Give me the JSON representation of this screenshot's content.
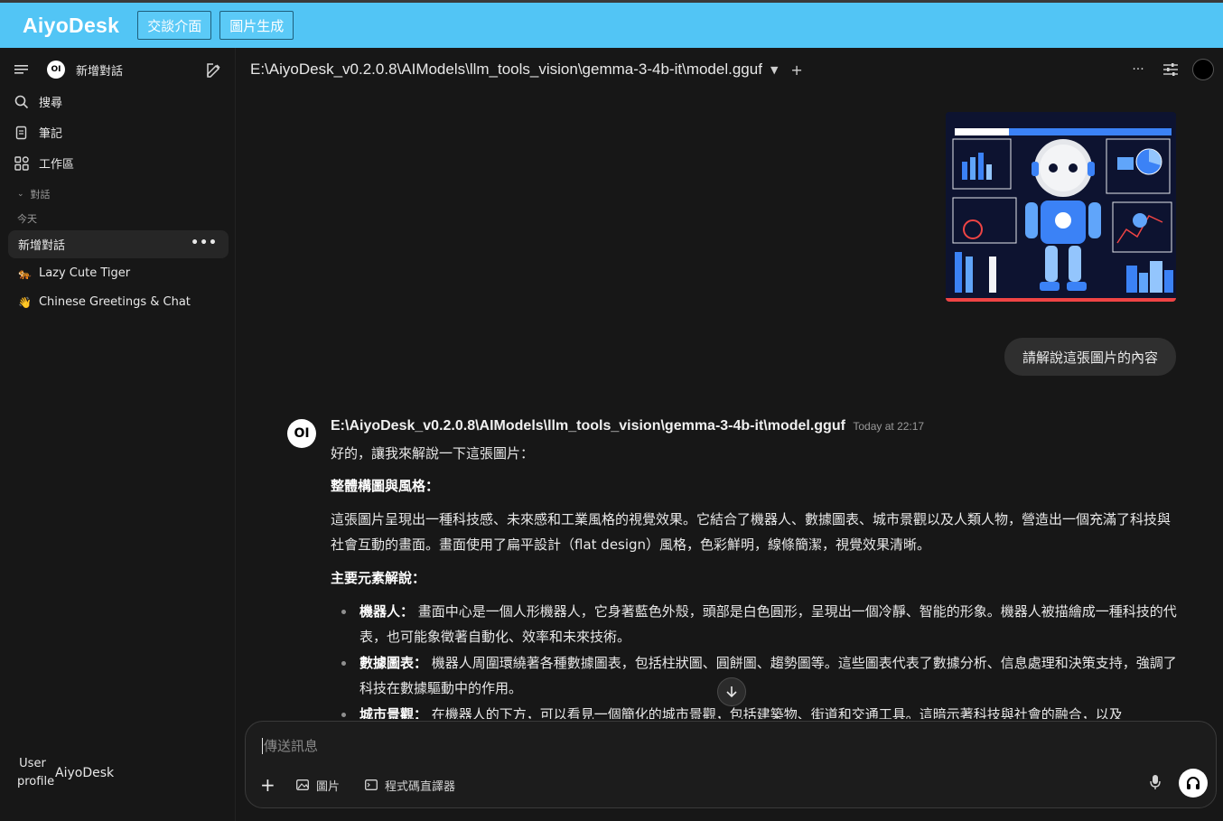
{
  "topbar": {
    "brand": "AiyoDesk",
    "tab_chat": "交談介面",
    "tab_image": "圖片生成"
  },
  "sidebar": {
    "new_chat": "新增對話",
    "search": "搜尋",
    "notes": "筆記",
    "workspace": "工作區",
    "section_chats": "對話",
    "section_today": "今天",
    "chats": [
      {
        "title": "新增對話",
        "emoji": ""
      },
      {
        "title": "Lazy Cute Tiger",
        "emoji": "🐅"
      },
      {
        "title": "Chinese Greetings & Chat",
        "emoji": "👋"
      }
    ],
    "user_image_alt": "User profile",
    "user_name": "AiyoDesk"
  },
  "header": {
    "model": "E:\\AiyoDesk_v0.2.0.8\\AIModels\\llm_tools_vision\\gemma-3-4b-it\\model.gguf"
  },
  "user_message": {
    "text": "請解說這張圖片的內容"
  },
  "assistant": {
    "avatar": "OI",
    "name": "E:\\AiyoDesk_v0.2.0.8\\AIModels\\llm_tools_vision\\gemma-3-4b-it\\model.gguf",
    "time": "Today at 22:17",
    "intro": "好的，讓我來解說一下這張圖片：",
    "h1": "整體構圖與風格：",
    "p1": "這張圖片呈現出一種科技感、未來感和工業風格的視覺效果。它結合了機器人、數據圖表、城市景觀以及人類人物，營造出一個充滿了科技與社會互動的畫面。畫面使用了扁平設計（flat design）風格，色彩鮮明，線條簡潔，視覺效果清晰。",
    "h2": "主要元素解說：",
    "items": [
      {
        "label": "機器人：",
        "text": " 畫面中心是一個人形機器人，它身著藍色外殼，頭部是白色圓形，呈現出一個冷靜、智能的形象。機器人被描繪成一種科技的代表，也可能象徵著自動化、效率和未來技術。"
      },
      {
        "label": "數據圖表：",
        "text": " 機器人周圍環繞著各種數據圖表，包括柱狀圖、圓餅圖、趨勢圖等。這些圖表代表了數據分析、信息處理和決策支持，強調了科技在數據驅動中的作用。"
      },
      {
        "label": "城市景觀：",
        "text": " 在機器人的下方，可以看見一個簡化的城市景觀，包括建築物、街道和交通工具。這暗示著科技與社會的融合，以及"
      }
    ]
  },
  "composer": {
    "placeholder": "傳送訊息",
    "image_tool": "圖片",
    "code_tool": "程式碼直譯器"
  },
  "colors": {
    "topbar": "#52c5f5",
    "background": "#171717",
    "bubble": "#2f2f2f"
  }
}
